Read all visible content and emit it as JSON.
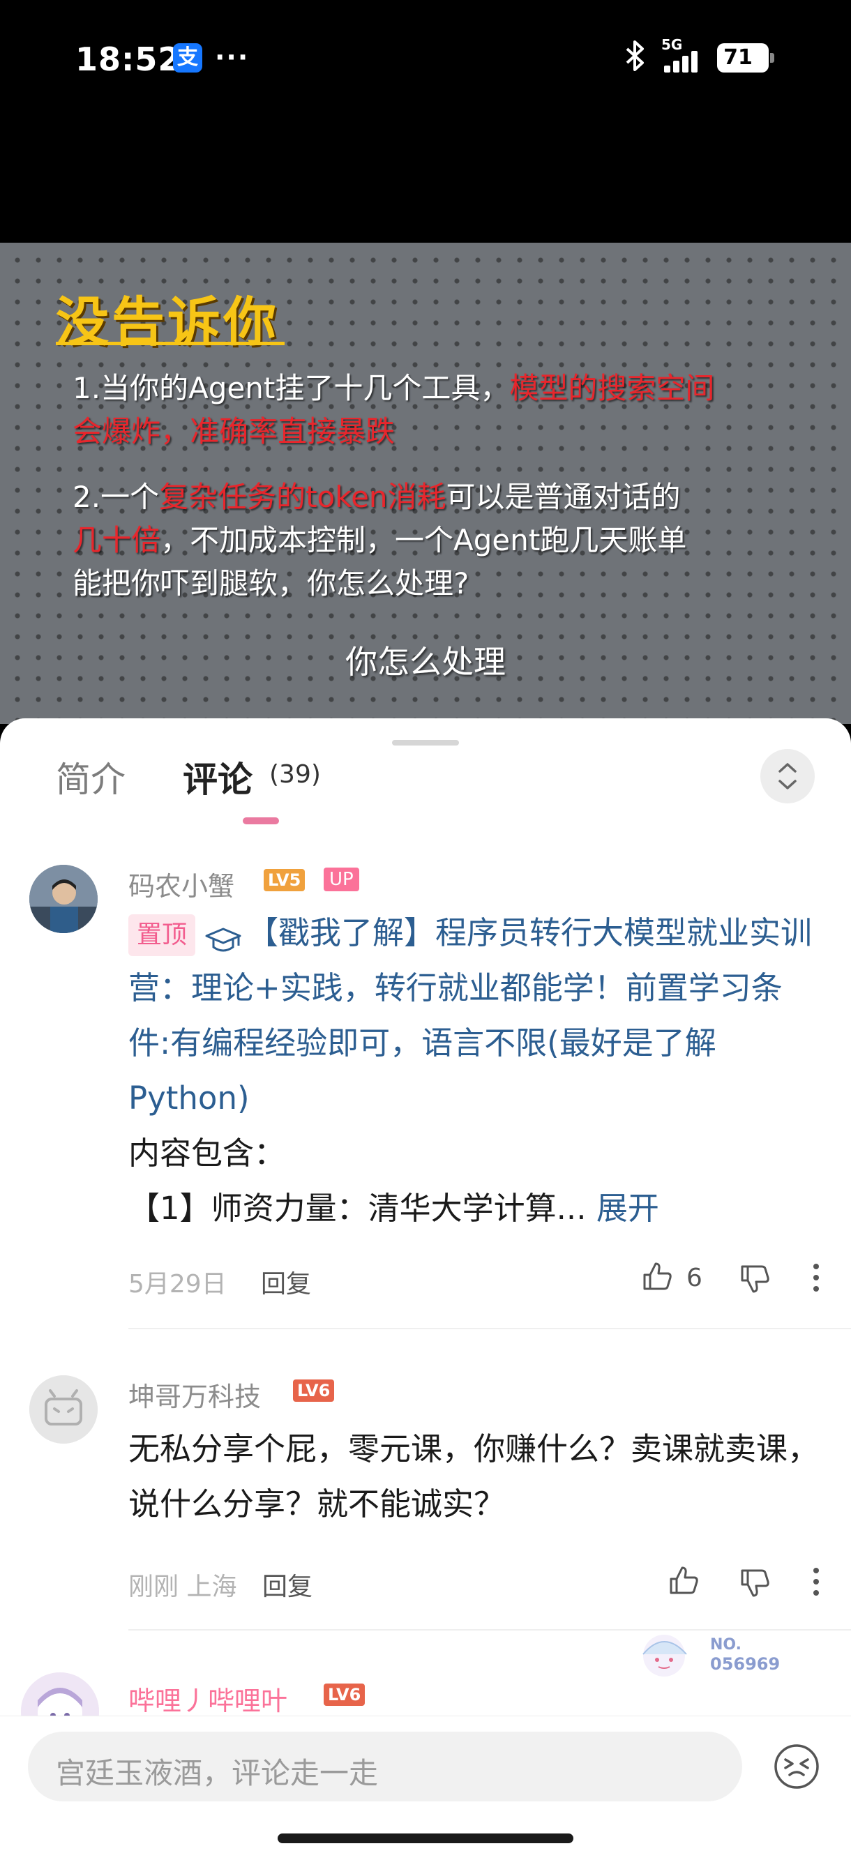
{
  "status_bar": {
    "time": "18:52",
    "app_badge": "支",
    "more": "···",
    "network": "5G",
    "battery": "71"
  },
  "video": {
    "title": "没告诉你",
    "line1_a": "1.当你的Agent挂了十几个工具，",
    "line1_b": "模型的搜索空间",
    "line1_c": "会爆炸，准确率直接暴跌",
    "line2_a": "2.一个",
    "line2_b": "复杂任务的token消耗",
    "line2_c": "可以是普通对话的",
    "line2_d": "几十倍",
    "line2_e": "，不加成本控制，一个Agent跑几天账单",
    "line2_f": "能把你吓到腿软，你怎么处理?",
    "subtitle": "你怎么处理"
  },
  "tabs": {
    "intro": "简介",
    "comments": "评论",
    "count": "(39)"
  },
  "comments": [
    {
      "user": "码农小蟹",
      "level": "LV5",
      "badge": "UP",
      "pinned": "置顶",
      "text_link": "【戳我了解】程序员转行大模型就业实训营：理论+实践，转行就业都能学！前置学习条件:有编程经验即可，语言不限(最好是了解 Python)",
      "text_plain1": "内容包含：",
      "text_plain2": "【1】师资力量：清华大学计算...",
      "expand": "展开",
      "date": "5月29日",
      "reply": "回复",
      "likes": "6"
    },
    {
      "user": "坤哥万科技",
      "level": "LV6",
      "text": "无私分享个屁，零元课，你赚什么？卖课就卖课，说什么分享？就不能诚实？",
      "date": "刚刚",
      "location": "上海",
      "reply": "回复"
    },
    {
      "user": "哔哩丿哔哩叶",
      "level": "LV6",
      "sticker_no": "NO.",
      "sticker_id": "056969"
    }
  ],
  "composer": {
    "placeholder": "宫廷玉液酒，评论走一走"
  },
  "colors": {
    "accent": "#fb7299",
    "link": "#2c5e91",
    "highlight": "#e8262c",
    "title_yellow": "#f7c516"
  },
  "icons": [
    "bluetooth-icon",
    "signal-icon",
    "battery-icon",
    "sort-icon",
    "graduation-cap-icon",
    "thumb-up-icon",
    "thumb-down-icon",
    "more-icon",
    "emoji-icon"
  ]
}
